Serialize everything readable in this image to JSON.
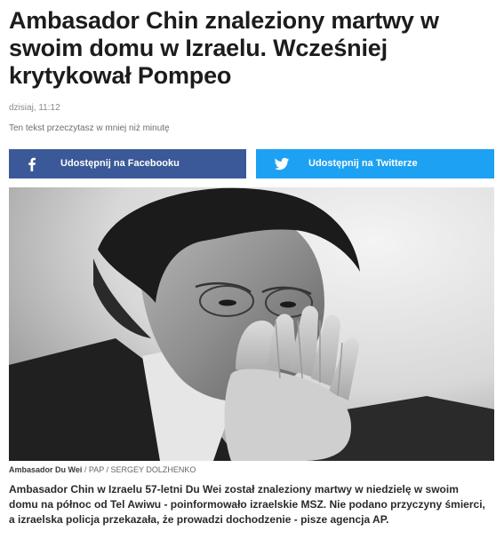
{
  "article": {
    "title": "Ambasador Chin znaleziony martwy w swoim domu w Izraelu. Wcześniej krytykował Pompeo",
    "date": "dzisiaj, 11:12",
    "read_time": "Ten tekst przeczytasz w mniej niż minutę",
    "lead": "Ambasador Chin w Izraelu 57-letni Du Wei został znaleziony martwy w niedzielę w swoim domu na północ od Tel Awiwu - poinformowało izraelskie MSZ. Nie podano przyczyny śmierci, a izraelska policja przekazała, że prowadzi dochodzenie - pisze agencja AP."
  },
  "share": {
    "facebook": {
      "label": "Udostępnij na Facebooku",
      "icon": "facebook-icon",
      "color": "#3b5998"
    },
    "twitter": {
      "label": "Udostępnij na Twitterze",
      "icon": "twitter-icon",
      "color": "#1da1f2"
    }
  },
  "photo": {
    "description_icon": "portrait-photo",
    "caption_subject": "Ambasador Du Wei",
    "caption_credit": " / PAP / SERGEY DOLZHENKO"
  }
}
